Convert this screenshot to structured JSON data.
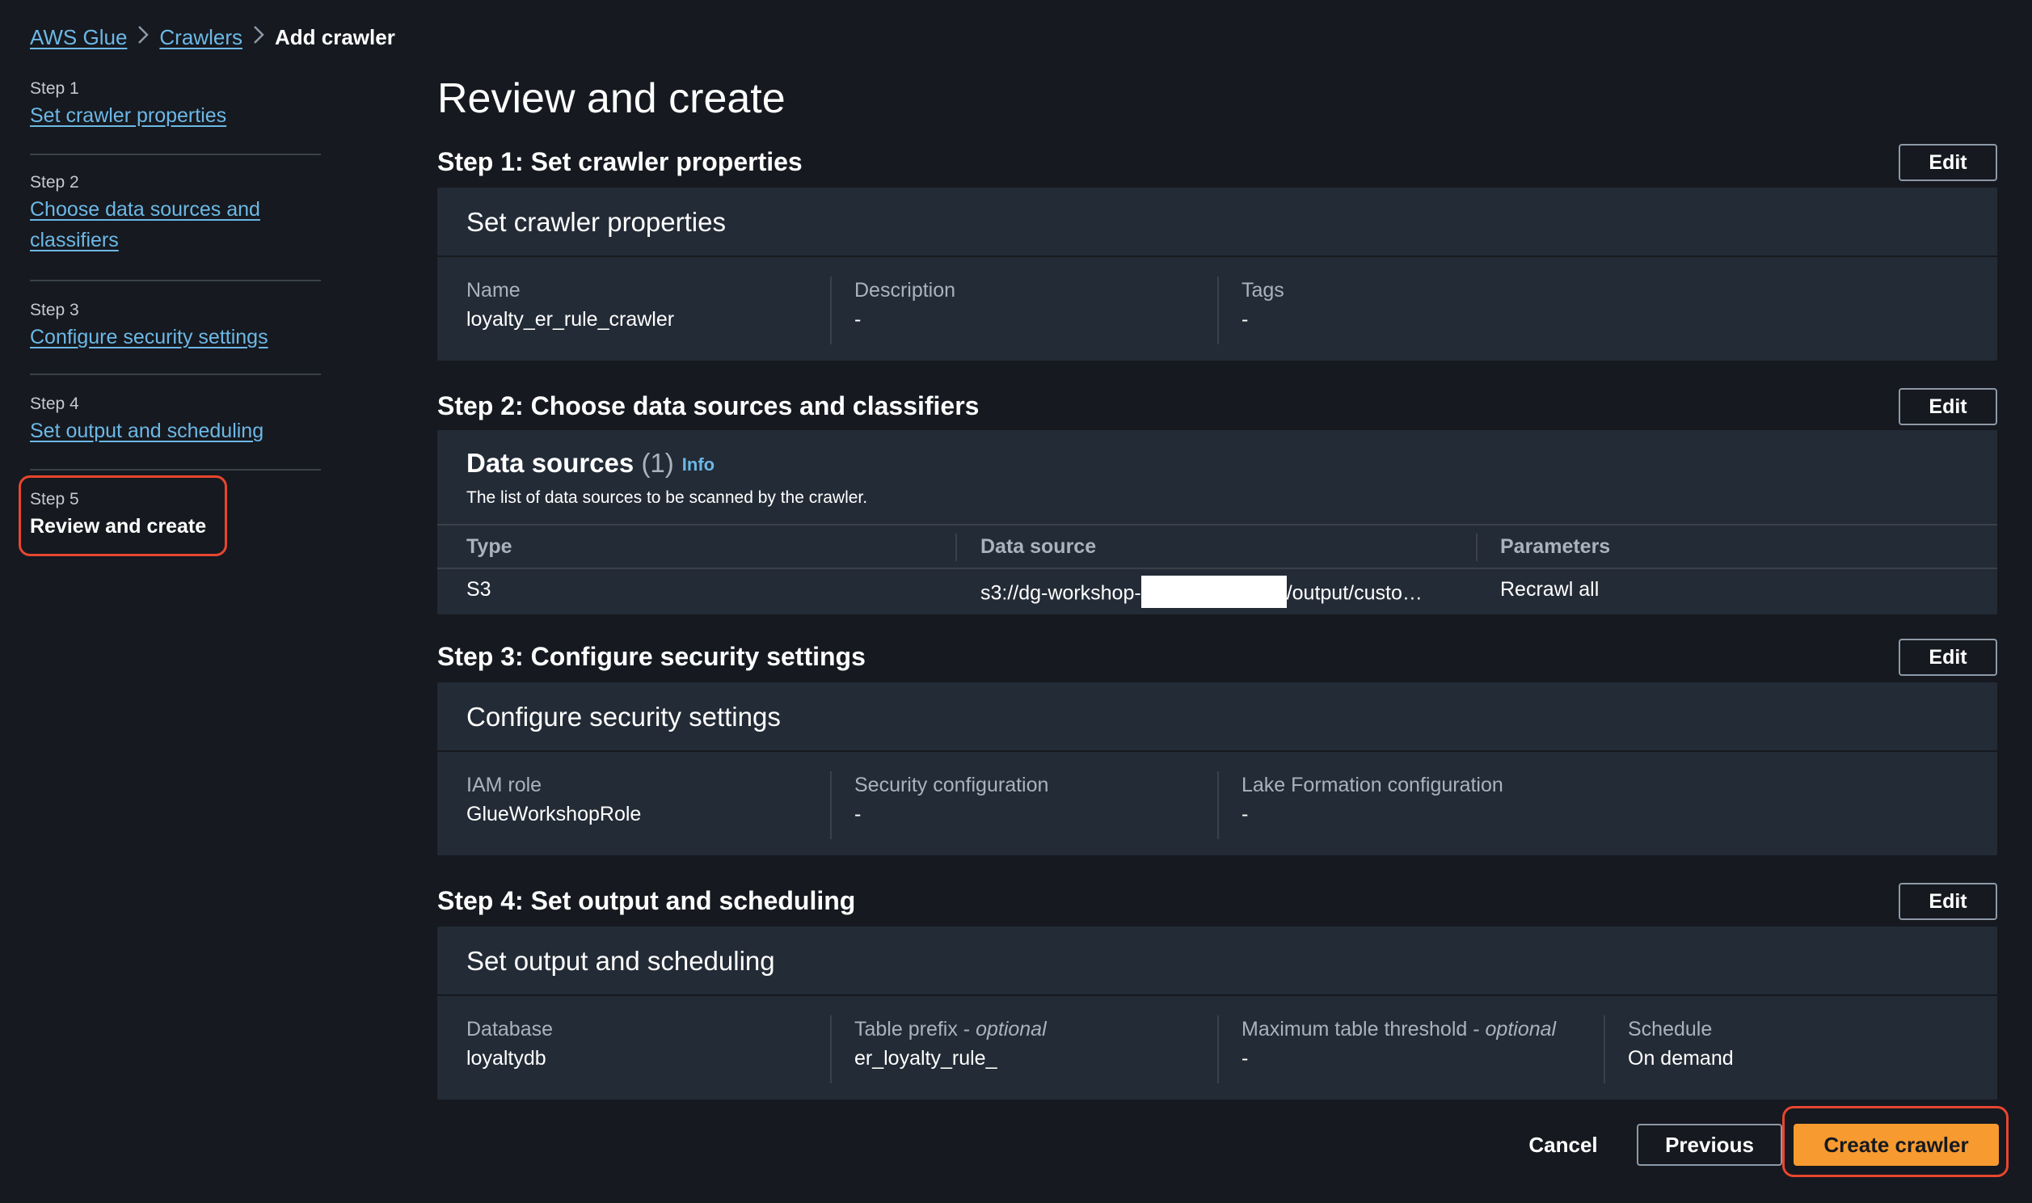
{
  "breadcrumb": {
    "items": [
      "AWS Glue",
      "Crawlers"
    ],
    "current": "Add crawler"
  },
  "sidebar": {
    "steps": [
      {
        "num": "Step 1",
        "label": "Set crawler properties"
      },
      {
        "num": "Step 2",
        "label": "Choose data sources and classifiers"
      },
      {
        "num": "Step 3",
        "label": "Configure security settings"
      },
      {
        "num": "Step 4",
        "label": "Set output and scheduling"
      },
      {
        "num": "Step 5",
        "label": "Review and create"
      }
    ]
  },
  "page": {
    "title": "Review and create"
  },
  "edit_label": "Edit",
  "step1": {
    "section_title": "Step 1: Set crawler properties",
    "card_title": "Set crawler properties",
    "fields": [
      {
        "label": "Name",
        "value": "loyalty_er_rule_crawler"
      },
      {
        "label": "Description",
        "value": "-"
      },
      {
        "label": "Tags",
        "value": "-"
      }
    ]
  },
  "step2": {
    "section_title": "Step 2: Choose data sources and classifiers",
    "ds_title": "Data sources",
    "ds_count": "(1)",
    "ds_info": "Info",
    "ds_desc": "The list of data sources to be scanned by the crawler.",
    "columns": [
      "Type",
      "Data source",
      "Parameters"
    ],
    "rows": [
      {
        "type": "S3",
        "source_prefix": "s3://dg-workshop-",
        "source_suffix": "/output/custo…",
        "parameters": "Recrawl all"
      }
    ]
  },
  "step3": {
    "section_title": "Step 3: Configure security settings",
    "card_title": "Configure security settings",
    "fields": [
      {
        "label": "IAM role",
        "value": "GlueWorkshopRole"
      },
      {
        "label": "Security configuration",
        "value": "-"
      },
      {
        "label": "Lake Formation configuration",
        "value": "-"
      }
    ]
  },
  "step4": {
    "section_title": "Step 4: Set output and scheduling",
    "card_title": "Set output and scheduling",
    "optional_text": "optional",
    "fields": [
      {
        "label": "Database",
        "value": "loyaltydb"
      },
      {
        "label": "Table prefix - ",
        "value": "er_loyalty_rule_"
      },
      {
        "label": "Maximum table threshold - ",
        "value": "-"
      },
      {
        "label": "Schedule",
        "value": "On demand"
      }
    ]
  },
  "footer": {
    "cancel": "Cancel",
    "previous": "Previous",
    "create": "Create crawler"
  }
}
